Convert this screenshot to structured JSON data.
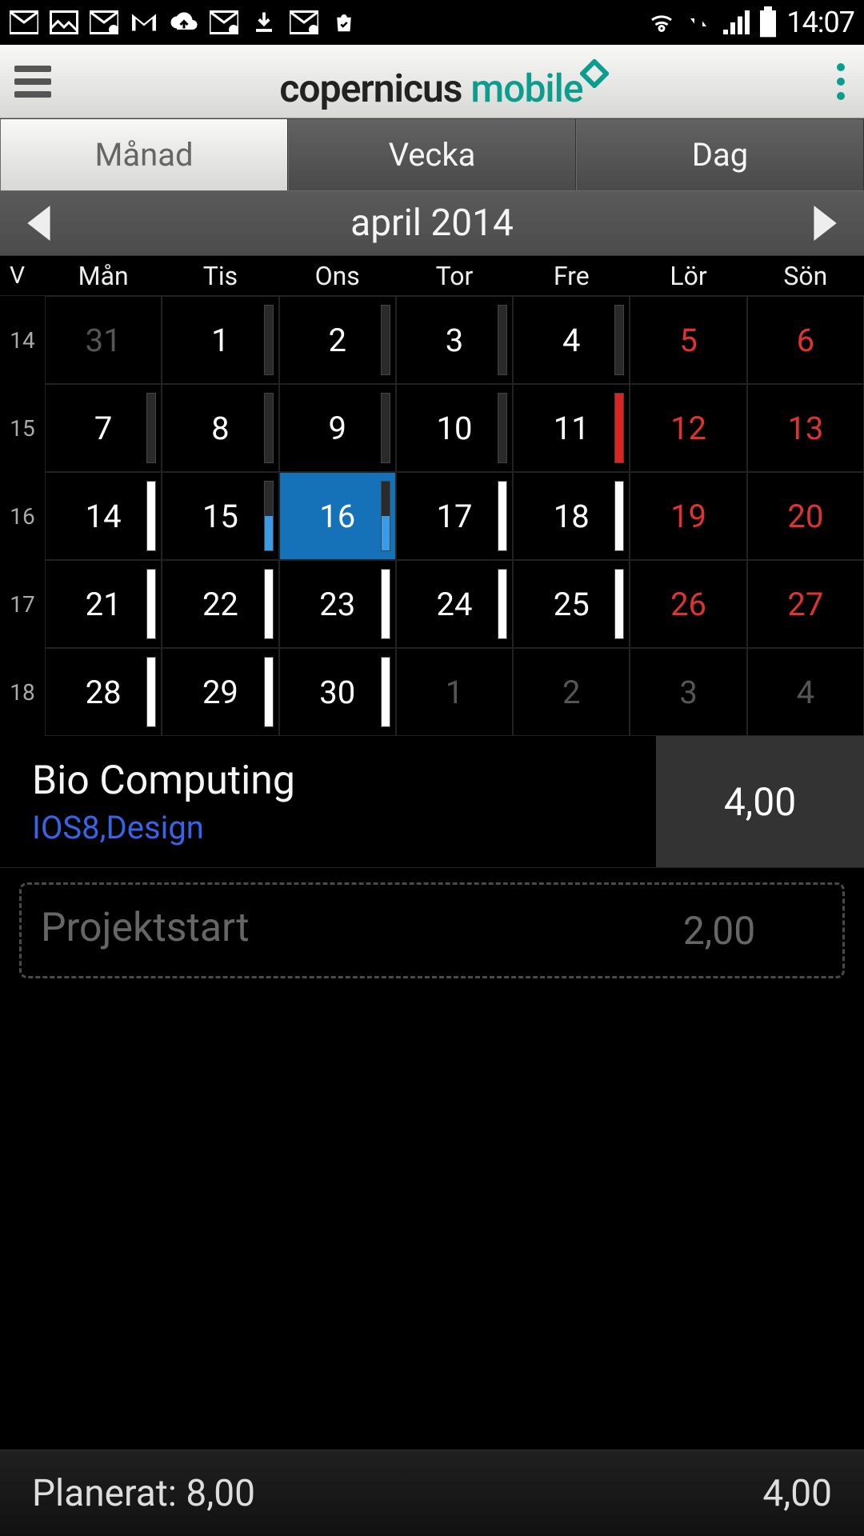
{
  "status": {
    "time": "14:07"
  },
  "header": {
    "brand_a": "copernicus ",
    "brand_b": "mobile"
  },
  "tabs": {
    "items": [
      {
        "label": "Månad",
        "active": true
      },
      {
        "label": "Vecka",
        "active": false
      },
      {
        "label": "Dag",
        "active": false
      }
    ]
  },
  "monthNav": {
    "label": "april 2014"
  },
  "calendar": {
    "weekHeader": "V",
    "dayHeaders": [
      "Mån",
      "Tis",
      "Ons",
      "Tor",
      "Fre",
      "Lör",
      "Sön"
    ],
    "weeks": [
      {
        "num": "14",
        "days": [
          {
            "n": "31",
            "other": true,
            "bar": null
          },
          {
            "n": "1",
            "bar": {
              "pct": 15,
              "color": "dark"
            }
          },
          {
            "n": "2",
            "bar": {
              "pct": 15,
              "color": "dark"
            }
          },
          {
            "n": "3",
            "bar": {
              "pct": 15,
              "color": "dark"
            }
          },
          {
            "n": "4",
            "bar": {
              "pct": 15,
              "color": "dark"
            }
          },
          {
            "n": "5",
            "weekend": true,
            "bar": null
          },
          {
            "n": "6",
            "weekend": true,
            "bar": null
          }
        ]
      },
      {
        "num": "15",
        "days": [
          {
            "n": "7",
            "bar": {
              "pct": 15,
              "color": "dark"
            }
          },
          {
            "n": "8",
            "bar": {
              "pct": 15,
              "color": "dark"
            }
          },
          {
            "n": "9",
            "bar": {
              "pct": 15,
              "color": "dark"
            }
          },
          {
            "n": "10",
            "bar": {
              "pct": 15,
              "color": "dark"
            }
          },
          {
            "n": "11",
            "bar": {
              "pct": 100,
              "color": "red"
            }
          },
          {
            "n": "12",
            "weekend": true,
            "bar": null
          },
          {
            "n": "13",
            "weekend": true,
            "bar": null
          }
        ]
      },
      {
        "num": "16",
        "days": [
          {
            "n": "14",
            "bar": {
              "pct": 100,
              "color": "white"
            }
          },
          {
            "n": "15",
            "bar": {
              "pct": 50,
              "color": "blue"
            }
          },
          {
            "n": "16",
            "today": true,
            "bar": {
              "pct": 50,
              "color": "blue"
            }
          },
          {
            "n": "17",
            "bar": {
              "pct": 100,
              "color": "white"
            }
          },
          {
            "n": "18",
            "bar": {
              "pct": 100,
              "color": "white"
            }
          },
          {
            "n": "19",
            "weekend": true,
            "bar": null
          },
          {
            "n": "20",
            "weekend": true,
            "bar": null
          }
        ]
      },
      {
        "num": "17",
        "days": [
          {
            "n": "21",
            "bar": {
              "pct": 100,
              "color": "white"
            }
          },
          {
            "n": "22",
            "bar": {
              "pct": 100,
              "color": "white"
            }
          },
          {
            "n": "23",
            "bar": {
              "pct": 100,
              "color": "white"
            }
          },
          {
            "n": "24",
            "bar": {
              "pct": 100,
              "color": "white"
            }
          },
          {
            "n": "25",
            "bar": {
              "pct": 100,
              "color": "white"
            }
          },
          {
            "n": "26",
            "weekend": true,
            "bar": null
          },
          {
            "n": "27",
            "weekend": true,
            "bar": null
          }
        ]
      },
      {
        "num": "18",
        "days": [
          {
            "n": "28",
            "bar": {
              "pct": 100,
              "color": "white"
            }
          },
          {
            "n": "29",
            "bar": {
              "pct": 100,
              "color": "white"
            }
          },
          {
            "n": "30",
            "bar": {
              "pct": 100,
              "color": "white"
            }
          },
          {
            "n": "1",
            "other": true,
            "bar": null
          },
          {
            "n": "2",
            "other": true,
            "bar": null
          },
          {
            "n": "3",
            "other": true,
            "bar": null
          },
          {
            "n": "4",
            "other": true,
            "bar": null
          }
        ]
      }
    ]
  },
  "entries": [
    {
      "title": "Bio Computing",
      "sub": "IOS8,Design",
      "value": "4,00",
      "ghost": false
    },
    {
      "title": "Projektstart",
      "sub": "",
      "value": "2,00",
      "ghost": true
    }
  ],
  "footer": {
    "planned_label": "Planerat: ",
    "planned_value": "8,00",
    "total": "4,00"
  }
}
